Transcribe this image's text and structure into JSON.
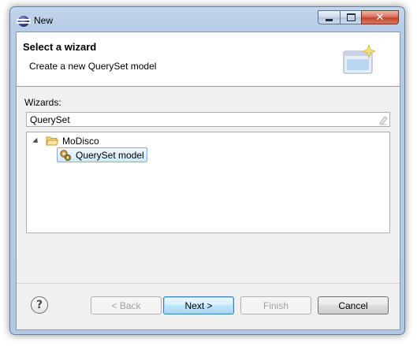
{
  "window": {
    "title": "New"
  },
  "banner": {
    "title": "Select a wizard",
    "subtitle": "Create a new QuerySet model"
  },
  "wizards": {
    "label": "Wizards:",
    "filter_value": "QuerySet",
    "tree": [
      {
        "label": "MoDisco",
        "expanded": true,
        "icon": "folder-open-icon",
        "children": [
          {
            "label": "QuerySet model",
            "icon": "queryset-model-icon",
            "selected": true
          }
        ]
      }
    ]
  },
  "buttons": {
    "help": "?",
    "back": "< Back",
    "next": "Next >",
    "finish": "Finish",
    "cancel": "Cancel"
  },
  "colors": {
    "selection_border": "#84acdd",
    "default_button_border": "#3c7fb1",
    "close_button": "#c2452f"
  }
}
